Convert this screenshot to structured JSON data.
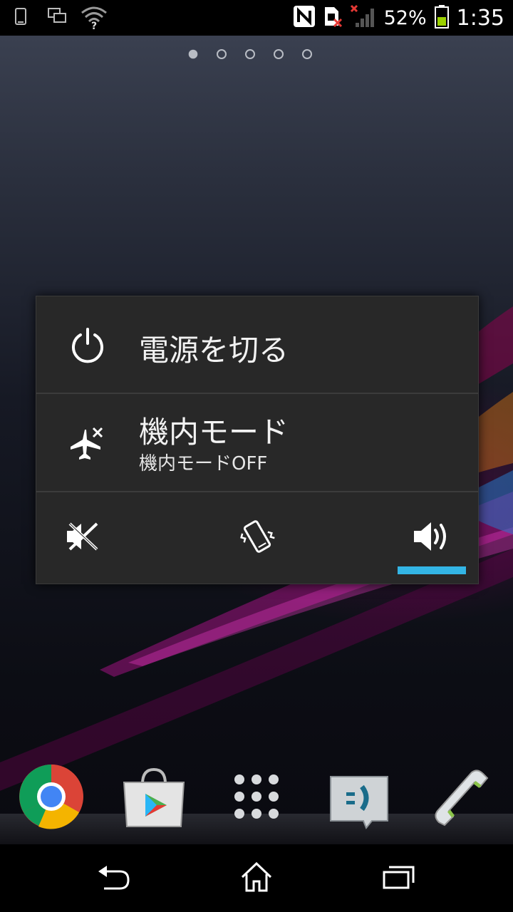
{
  "status_bar": {
    "left_icons": [
      "phone-outline-icon",
      "screen-mirror-icon",
      "wifi-question-icon"
    ],
    "right_icons": [
      "nfc-icon",
      "sim-missing-icon",
      "signal-no-service-icon",
      "battery-icon"
    ],
    "battery_percent": "52%",
    "battery_level": 0.52,
    "time": "1:35"
  },
  "home": {
    "page_count": 5,
    "active_page": 1
  },
  "power_dialog": {
    "power_off": {
      "label": "電源を切る",
      "icon": "power-icon"
    },
    "airplane_mode": {
      "label": "機内モード",
      "status": "機内モードOFF",
      "icon": "airplane-off-icon"
    },
    "sound_modes": [
      {
        "name": "silent",
        "icon": "silent-icon",
        "selected": false
      },
      {
        "name": "vibrate",
        "icon": "vibrate-icon",
        "selected": false
      },
      {
        "name": "sound-on",
        "icon": "volume-on-icon",
        "selected": true
      }
    ],
    "accent_color": "#33b5e5"
  },
  "dock": {
    "apps": [
      {
        "name": "Chrome",
        "icon": "chrome-icon"
      },
      {
        "name": "Play Store",
        "icon": "play-store-icon"
      },
      {
        "name": "App drawer",
        "icon": "app-drawer-icon"
      },
      {
        "name": "Messaging",
        "icon": "messaging-icon"
      },
      {
        "name": "Phone",
        "icon": "phone-icon"
      }
    ]
  },
  "nav_bar": {
    "buttons": [
      "back-icon",
      "home-icon",
      "recents-icon"
    ]
  }
}
